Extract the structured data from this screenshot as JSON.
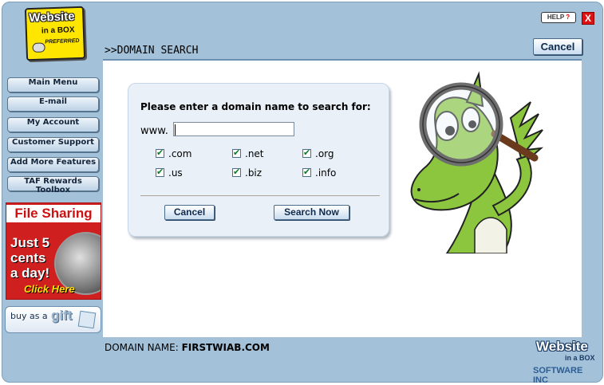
{
  "logo": {
    "line1": "Website",
    "line2": "in a BOX",
    "line3": "PREFERRED"
  },
  "header": {
    "help_label": "HELP",
    "help_mark": "?",
    "close_label": "X",
    "cancel_label": "Cancel",
    "page_title": ">>DOMAIN SEARCH"
  },
  "sidebar": {
    "items": [
      {
        "label": "Main Menu"
      },
      {
        "label": "E-mail"
      },
      {
        "label": "My Account"
      },
      {
        "label": "Customer Support"
      },
      {
        "label": "Add More Features"
      },
      {
        "label": "TAF Rewards Toolbox"
      }
    ],
    "promo": {
      "title": "File Sharing",
      "line1": "Just 5",
      "line2": "cents",
      "line3": "a day!",
      "cta": "Click Here"
    },
    "gift": {
      "text": "buy as a",
      "word": "gift"
    }
  },
  "search": {
    "prompt": "Please enter a domain name to search for:",
    "prefix": "www.",
    "input_value": "",
    "tlds": [
      {
        "label": ".com",
        "checked": true
      },
      {
        "label": ".net",
        "checked": true
      },
      {
        "label": ".org",
        "checked": true
      },
      {
        "label": ".us",
        "checked": true
      },
      {
        "label": ".biz",
        "checked": true
      },
      {
        "label": ".info",
        "checked": true
      }
    ],
    "cancel_label": "Cancel",
    "search_label": "Search Now"
  },
  "footer": {
    "domain_label": "DOMAIN NAME:",
    "domain_value": "FIRSTWIAB.COM",
    "brand_line1": "Website",
    "brand_line2": "in a BOX",
    "brand_line3": "SOFTWARE INC"
  },
  "colors": {
    "frame": "#a3c1d9",
    "accent": "#0f2a4d",
    "close": "#dd1111",
    "check": "#0d7a28",
    "dragon": "#8cc63f"
  },
  "icons": {
    "mascot": "dragon-with-magnifier-icon",
    "close": "close-icon",
    "help": "help-icon"
  }
}
